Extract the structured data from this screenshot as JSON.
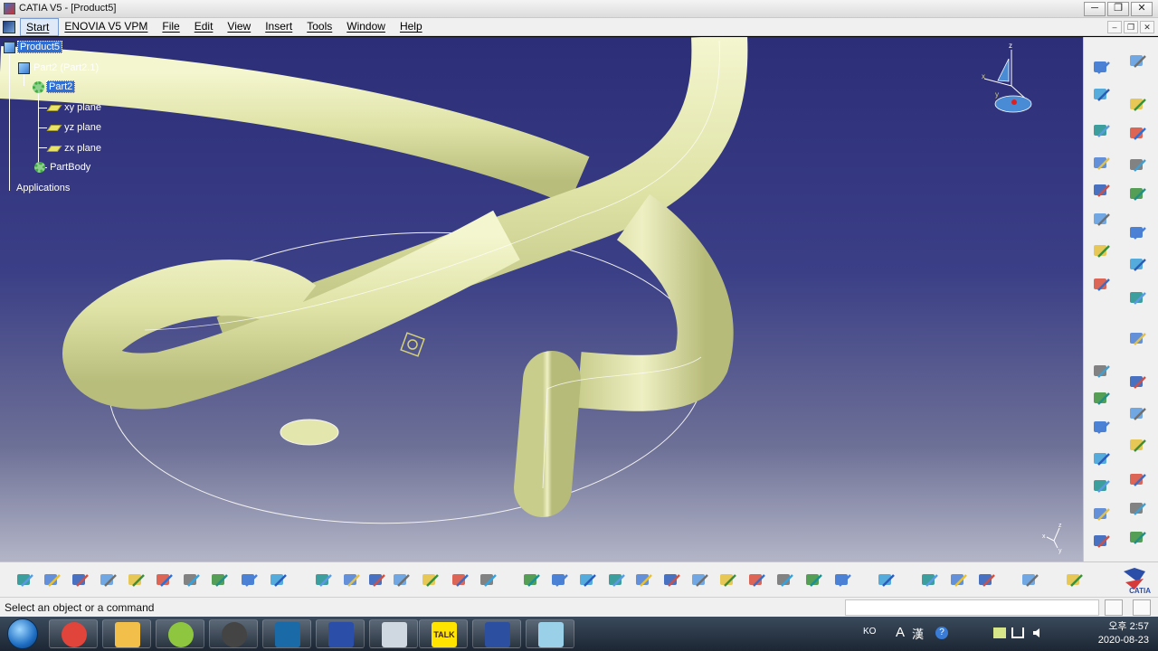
{
  "window": {
    "title": "CATIA V5 - [Product5]",
    "controls": {
      "minimize": "─",
      "restore": "❐",
      "close": "✕"
    }
  },
  "menu": {
    "items": [
      "Start",
      "ENOVIA V5 VPM",
      "File",
      "Edit",
      "View",
      "Insert",
      "Tools",
      "Window",
      "Help"
    ],
    "mdi_controls": {
      "minimize": "–",
      "restore": "❐",
      "close": "✕"
    }
  },
  "tree": {
    "root": "Product5",
    "part_instance": "Part2 (Part2.1)",
    "part": "Part2",
    "planes": [
      "xy plane",
      "yz plane",
      "zx plane"
    ],
    "body": "PartBody",
    "applications": "Applications"
  },
  "compass_axes": {
    "z": "z",
    "x": "x",
    "y": "y"
  },
  "viewport_axes": {
    "z": "z",
    "x": "x",
    "y": "y"
  },
  "right_toolbar": {
    "col1_icons": [
      "point-icon",
      "line-icon",
      "plane-icon",
      "sweep-icon",
      "helix-icon",
      "projection-icon",
      "corner-icon",
      "connect-icon",
      "extract-icon",
      "fill-icon",
      "extrude-icon",
      "revolve-icon",
      "offset-icon",
      "sphere-icon",
      "split-icon"
    ],
    "col2_icons": [
      "knowledge-icon",
      "constraint-icon",
      "constraint-face-icon",
      "axis-system-icon",
      "select-arrow-icon",
      "snap-icon",
      "sketch-icon",
      "curve-icon",
      "table-icon",
      "boundary-icon",
      "blend-icon",
      "trim-icon",
      "join-icon",
      "healing-icon",
      "translate-icon"
    ]
  },
  "bottom_toolbar": {
    "icons": [
      "new-icon",
      "open-icon",
      "save-icon",
      "print-icon",
      "cut-icon",
      "copy-icon",
      "paste-icon",
      "undo-icon",
      "redo-icon",
      "whats-this-icon",
      "formula-icon",
      "comment-icon",
      "knowledge-rule-icon",
      "table-icon",
      "tree-icon",
      "lock-icon",
      "analysis-icon",
      "fly-mode-icon",
      "fit-all-icon",
      "pan-icon",
      "rotate-icon",
      "zoom-in-icon",
      "zoom-out-icon",
      "normal-view-icon",
      "multi-view-icon",
      "iso-view-icon",
      "shading-icon",
      "hide-show-icon",
      "swap-visible-icon",
      "measure-between-icon",
      "measure-item-icon",
      "inertia-icon",
      "bottle-icon",
      "capture-icon",
      "update-icon"
    ],
    "brand": "CATIA"
  },
  "status": {
    "text": "Select an object or a command",
    "command_input": ""
  },
  "taskbar": {
    "apps": [
      "chrome-icon",
      "explorer-icon",
      "android-icon",
      "obs-icon",
      "window-icon",
      "catia-icon",
      "settings-icon",
      "kakaotalk-icon",
      "catia-active-icon",
      "app-icon"
    ],
    "talk_label": "TALK",
    "tray": {
      "lang": "KO",
      "ime_a": "A",
      "ime_hanja": "漢"
    },
    "time": "오후 2:57",
    "date": "2020-08-23"
  },
  "colors": {
    "viewport_top": "#2c2e78",
    "viewport_bottom": "#b3b5c7",
    "tube": "#e9ecb6",
    "tree_selection": "#2e6fd6"
  }
}
